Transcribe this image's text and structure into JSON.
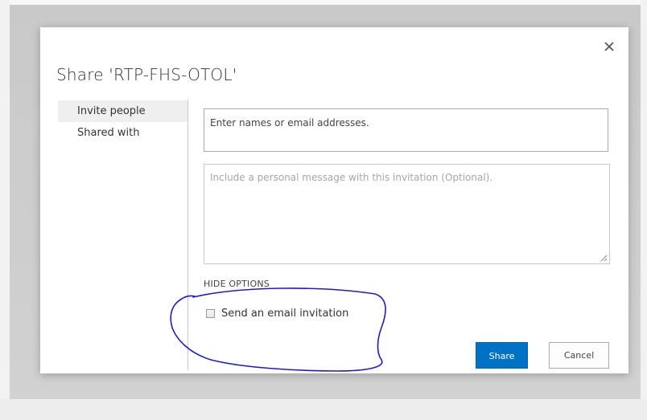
{
  "dialog": {
    "title": "Share 'RTP-FHS-OTOL'",
    "close_icon": "close-icon"
  },
  "nav": {
    "items": [
      {
        "label": "Invite people",
        "selected": true
      },
      {
        "label": "Shared with",
        "selected": false
      }
    ]
  },
  "form": {
    "names_placeholder": "Enter names or email addresses.",
    "message_placeholder": "Include a personal message with this invitation (Optional).",
    "hide_options_label": "HIDE OPTIONS",
    "email_invitation_label": "Send an email invitation",
    "email_invitation_checked": false
  },
  "buttons": {
    "share_label": "Share",
    "cancel_label": "Cancel"
  },
  "colors": {
    "accent": "#0072c6",
    "annotation_ink": "#1c1ccf"
  }
}
